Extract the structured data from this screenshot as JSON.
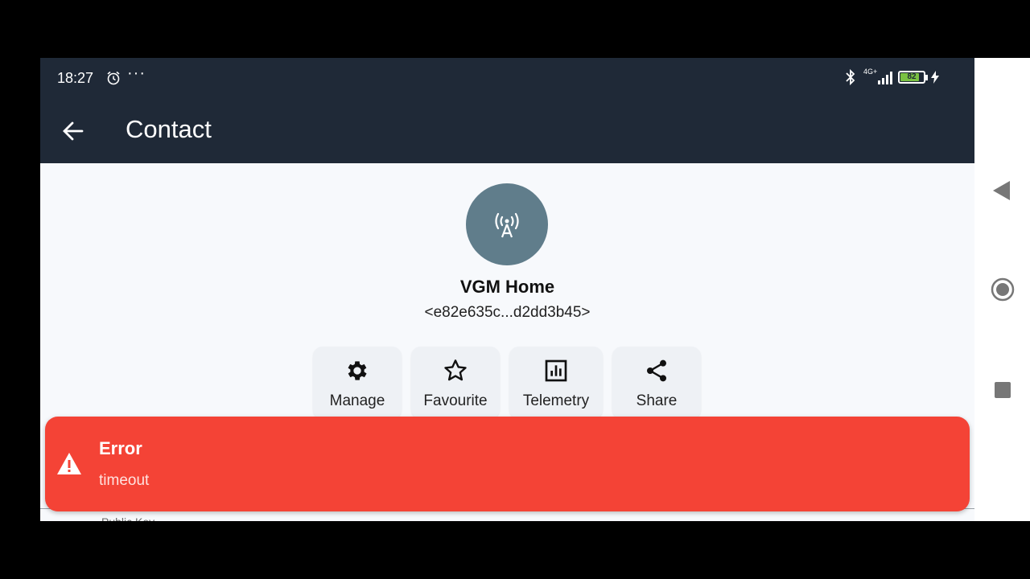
{
  "status_bar": {
    "time": "18:27",
    "more": "···",
    "network": "4G+",
    "battery_level": "82",
    "battery_fraction": 0.82,
    "icons": [
      "alarm-icon",
      "bluetooth-icon",
      "signal-icon",
      "battery-icon",
      "charging-icon"
    ]
  },
  "app_bar": {
    "title": "Contact",
    "back_icon": "arrow-left-icon"
  },
  "contact": {
    "avatar_icon": "antenna-icon",
    "avatar_color": "#607d8b",
    "name": "VGM Home",
    "public_key_short": "<e82e635c...d2dd3b45>"
  },
  "actions": [
    {
      "label": "Manage",
      "icon": "gear-icon"
    },
    {
      "label": "Favourite",
      "icon": "star-icon"
    },
    {
      "label": "Telemetry",
      "icon": "chart-icon"
    },
    {
      "label": "Share",
      "icon": "share-icon"
    }
  ],
  "toast": {
    "title": "Error",
    "message": "timeout",
    "icon": "warning-icon",
    "color": "#f44336"
  },
  "below_label": "Public Key",
  "colors": {
    "app_bar": "#1f2937",
    "background": "#f7f9fc",
    "battery": "#7ac143"
  }
}
